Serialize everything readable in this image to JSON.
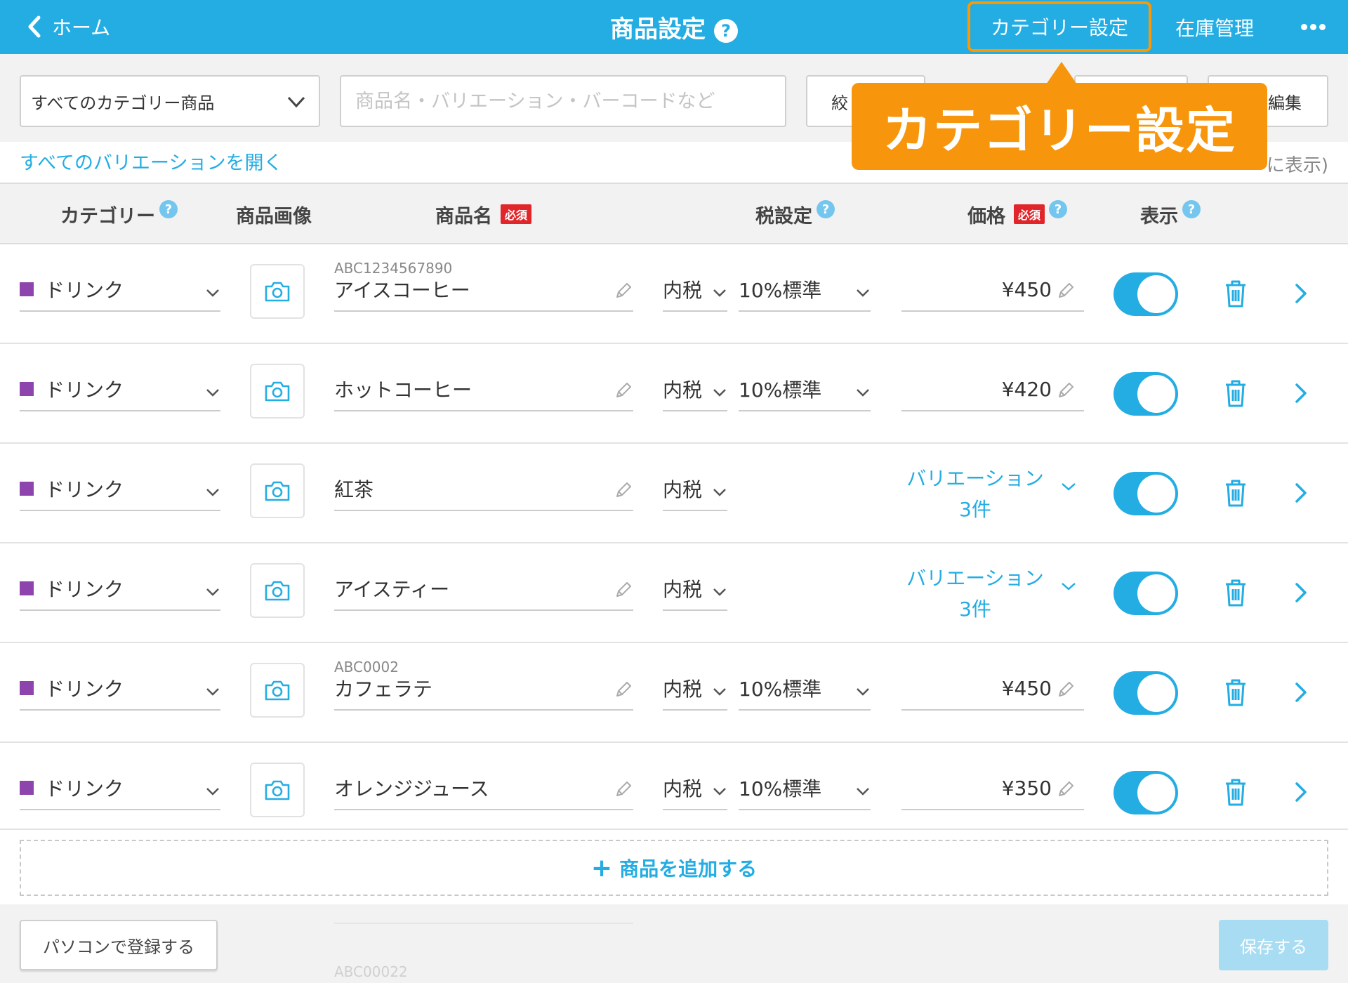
{
  "header": {
    "back_label": "ホーム",
    "title": "商品設定",
    "help": "?",
    "category_settings": "カテゴリー設定",
    "inventory": "在庫管理",
    "accent_color": "#23ade3",
    "highlight_color": "#ff9800"
  },
  "toolbar": {
    "category_select": "すべてのカテゴリー商品",
    "search_placeholder": "商品名・バリエーション・バーコードなど",
    "filter_label": "絞",
    "edit_label": "編集"
  },
  "open_all_variations": "すべてのバリエーションを開く",
  "count_text": "に表示)",
  "callout": "カテゴリー設定",
  "table": {
    "headers": {
      "category": "カテゴリー",
      "image": "商品画像",
      "name": "商品名",
      "required": "必須",
      "tax": "税設定",
      "price": "価格",
      "visible": "表示"
    },
    "rows": [
      {
        "category": "ドリンク",
        "code": "ABC1234567890",
        "name": "アイスコーヒー",
        "tax": "内税",
        "rate": "10%標準",
        "price": "¥450",
        "variation": null,
        "visible": true
      },
      {
        "category": "ドリンク",
        "code": "",
        "name": "ホットコーヒー",
        "tax": "内税",
        "rate": "10%標準",
        "price": "¥420",
        "variation": null,
        "visible": true
      },
      {
        "category": "ドリンク",
        "code": "",
        "name": "紅茶",
        "tax": "内税",
        "rate": "",
        "price": "",
        "variation": "バリエーション",
        "variation_count": "3件",
        "visible": true
      },
      {
        "category": "ドリンク",
        "code": "",
        "name": "アイスティー",
        "tax": "内税",
        "rate": "",
        "price": "",
        "variation": "バリエーション",
        "variation_count": "3件",
        "visible": true
      },
      {
        "category": "ドリンク",
        "code": "ABC0002",
        "name": "カフェラテ",
        "tax": "内税",
        "rate": "10%標準",
        "price": "¥450",
        "variation": null,
        "visible": true
      },
      {
        "category": "ドリンク",
        "code": "",
        "name": "オレンジジュース",
        "tax": "内税",
        "rate": "10%標準",
        "price": "¥350",
        "variation": null,
        "visible": true
      }
    ]
  },
  "add_product": "商品を追加する",
  "footer": {
    "pc_register": "パソコンで登録する",
    "save": "保存する",
    "ghost_code": "ABC00022"
  },
  "icons": {
    "back": "chevron-left-icon",
    "camera": "camera-icon",
    "pencil": "pencil-icon",
    "trash": "trash-icon",
    "arrow": "chevron-right-icon",
    "more": "more-dots-icon"
  },
  "category_color": "#8e44ad"
}
